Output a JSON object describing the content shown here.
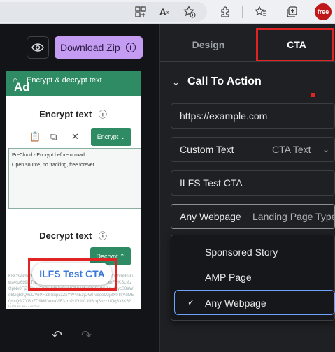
{
  "browser": {
    "icons": [
      "grid-plus-icon",
      "read-aloud-icon",
      "add-favorite-icon",
      "extensions-icon",
      "favorites-icon",
      "collections-icon"
    ],
    "profile_badge": "free"
  },
  "editor": {
    "download_label": "Download Zip",
    "preview": {
      "app_title": "Encrypt & decrypt text",
      "ad_badge": "Ad",
      "encrypt_heading": "Encrypt text",
      "encrypt_select": "Encrypt",
      "textarea_line1": "PreCloud - Encrypt before upload",
      "textarea_line2": "Open source, no tracking, free forever.",
      "decrypt_heading": "Decrypt text",
      "decrypt_select": "Decrypt",
      "output_text": "KBC3j4k9iQhjKcQlXzk9ldGhpcyBpcyBzb21lIHRleHQ2Ro3hmHn9uwa4sz6b9IzTN8xy3n2lpbmt1yVqD5rFw6hJ8sw93/M2xnFq/KSLI8zQpNx0FjZ9RpsvT3BkYWNlcGxhY2VoN4wSKtPcWHNw4qycS8aWe6Gqb3QYuDVoPFtqbGxpc2ZkYW4kE3jOWPv9eeOzjBX0TkVdM5QssQ9tZXBoZD9kM3e=aV/F3zm2U0hhC3N6cqSuzz1fQq833K62WCVSJ0zcr0GV"
    },
    "cta_bubble": "ILFS Test CTA"
  },
  "panel": {
    "tabs": [
      "Design",
      "CTA"
    ],
    "active_tab": "CTA",
    "section_title": "Call To Action",
    "url_value": "https://example.com",
    "custom_text_label": "Custom Text",
    "custom_text_select": "CTA Text",
    "cta_text_value": "ILFS Test CTA",
    "landing_label": "Any Webpage",
    "landing_placeholder": "Landing Page Type",
    "landing_options": [
      "Sponsored Story",
      "AMP Page",
      "Any Webpage"
    ],
    "landing_selected": "Any Webpage"
  },
  "colors": {
    "accent_purple": "#c49cf2",
    "preview_green": "#2e8b63",
    "highlight_red": "#e02424",
    "focus_blue": "#6fa2ff"
  }
}
